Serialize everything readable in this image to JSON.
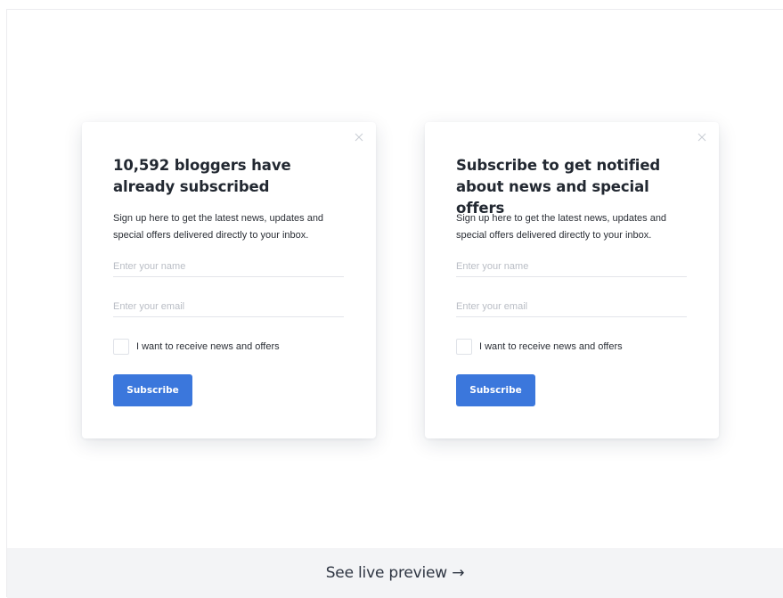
{
  "cards": [
    {
      "title": "10,592 bloggers have already subscribed",
      "description": "Sign up here to get the latest news, updates and special offers delivered directly to your inbox.",
      "name_placeholder": "Enter your name",
      "email_placeholder": "Enter your email",
      "checkbox_label": "I want to receive news and offers",
      "subscribe_label": "Subscribe"
    },
    {
      "title": "Subscribe to get notified about news and special offers",
      "description": "Sign up here to get the latest news, updates and special offers delivered directly to your inbox.",
      "name_placeholder": "Enter your name",
      "email_placeholder": "Enter your email",
      "checkbox_label": "I want to receive news and offers",
      "subscribe_label": "Subscribe"
    }
  ],
  "footer": {
    "preview_link": "See live preview →"
  },
  "colors": {
    "button": "#3b77dc",
    "footer_bg": "#f3f4f6",
    "title_text": "#222831"
  },
  "icons": {
    "close": "close-icon"
  }
}
